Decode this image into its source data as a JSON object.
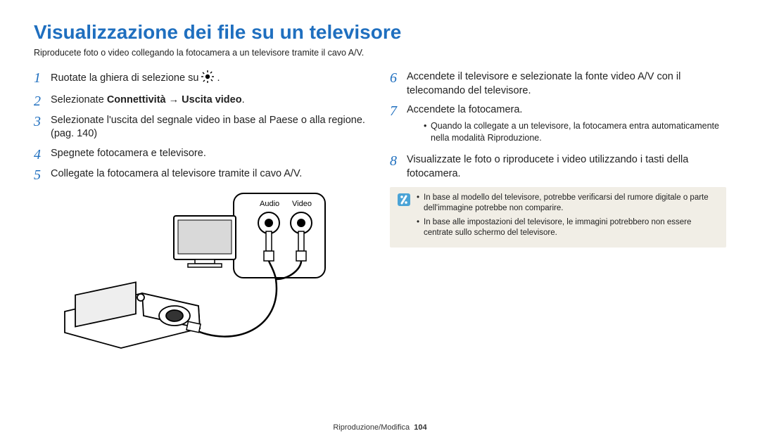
{
  "title": "Visualizzazione dei file su un televisore",
  "subtitle": "Riproducete foto o video collegando la fotocamera a un televisore tramite il cavo A/V.",
  "left_steps": {
    "s1_a": "Ruotate la ghiera di selezione su ",
    "s1_b": " .",
    "s2_a": "Selezionate ",
    "s2_b": "Connettività",
    "s2_c": " → ",
    "s2_d": "Uscita video",
    "s2_e": ".",
    "s3": "Selezionate l'uscita del segnale video in base al Paese o alla regione. (pag. 140)",
    "s4": "Spegnete fotocamera e televisore.",
    "s5": "Collegate la fotocamera al televisore tramite il cavo A/V."
  },
  "right_steps": {
    "s6": "Accendete il televisore e selezionate la fonte video A/V con il telecomando del televisore.",
    "s7": "Accendete la fotocamera.",
    "s7_sub": "Quando la collegate a un televisore, la fotocamera entra automaticamente nella modalità Riproduzione.",
    "s8": "Visualizzate le foto o riproducete i video utilizzando i tasti della fotocamera."
  },
  "note": {
    "n1": "In base al modello del televisore, potrebbe verificarsi del rumore digitale o parte dell'immagine potrebbe non comparire.",
    "n2": "In base alle impostazioni del televisore, le immagini potrebbero non essere centrate sullo schermo del televisore."
  },
  "diagram": {
    "audio_label": "Audio",
    "video_label": "Video"
  },
  "footer": {
    "section": "Riproduzione/Modifica",
    "page": "104"
  }
}
